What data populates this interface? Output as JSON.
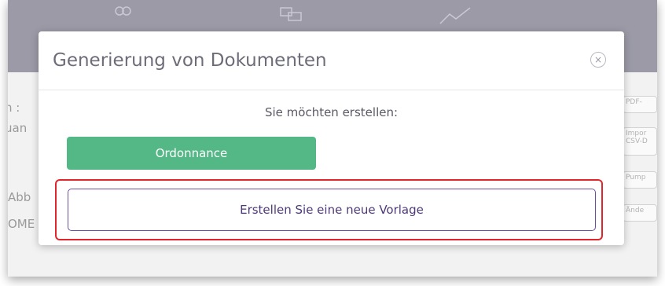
{
  "modal": {
    "title": "Generierung von Dokumenten",
    "close_icon": "×",
    "prompt": "Sie möchten erstellen:",
    "ordonnance_button": "Ordonnance",
    "new_template_button": "Erstellen Sie eine neue Vorlage"
  },
  "background": {
    "left_texts": [
      "n :",
      "uan",
      "Abb",
      "OME"
    ],
    "right_buttons": [
      "PDF-",
      "Impor\nCSV-D",
      "Pump",
      "Ände"
    ],
    "header_icons": [
      "users-icon",
      "chat-icon",
      "chart-icon"
    ]
  },
  "colors": {
    "green_button": "#53b886",
    "outline_button_border": "#6a4fa0",
    "highlight_border": "#e0252c",
    "header_overlay": "#9b9aa6"
  }
}
